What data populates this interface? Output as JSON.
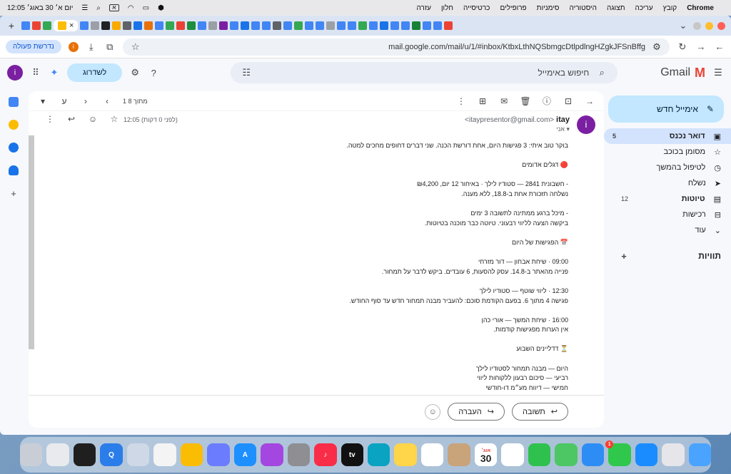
{
  "menubar": {
    "apple": "",
    "app": "Chrome",
    "menus": [
      "קובץ",
      "עריכה",
      "תצוגה",
      "היסטוריה",
      "סימניות",
      "פרופילים",
      "כרטיסייה",
      "חלון",
      "עזרה"
    ],
    "datetime": "יום א׳ 30 באוג׳ 12:05",
    "input_lang": "א"
  },
  "browser": {
    "url": "mail.google.com/mail/u/1/#inbox/KtbxLthNQSbmgcDtlpdlngHZgkJFSnBffg",
    "action_pill": "נדרשת פעולה",
    "profile_letter": "i",
    "tab_favicon_colors": [
      "#4285f4",
      "#ea4335",
      "#34a853",
      "#fbbc04",
      "#4285f4",
      "#9aa0a6",
      "#202124",
      "#f9ab00",
      "#5f6368",
      "#1a73e8",
      "#e8710a",
      "#4285f4",
      "#34a853",
      "#ea4335",
      "#1e8e3e",
      "#4285f4",
      "#9aa0a6",
      "#7b1fa2",
      "#4285f4",
      "#1a73e8",
      "#4285f4",
      "#4285f4",
      "#5f6368",
      "#4285f4",
      "#34a853",
      "#4285f4",
      "#4285f4",
      "#9aa0a6",
      "#4285f4",
      "#4285f4",
      "#34a853",
      "#4285f4",
      "#1a73e8",
      "#4285f4",
      "#4285f4",
      "#188038",
      "#4285f4",
      "#4285f4",
      "#ea4335"
    ]
  },
  "gmail": {
    "logo_text": "Gmail",
    "search_placeholder": "חיפוש באימייל",
    "upgrade": "לשדרוג",
    "avatar": "i",
    "compose": "אימייל חדש",
    "nav": [
      {
        "label": "דואר נכנס",
        "count": "5",
        "icon": "inbox-icon",
        "active": true,
        "bold": true
      },
      {
        "label": "מסומן בכוכב",
        "count": "",
        "icon": "star-icon",
        "active": false,
        "bold": false
      },
      {
        "label": "לטיפול בהמשך",
        "count": "",
        "icon": "clock-icon",
        "active": false,
        "bold": false
      },
      {
        "label": "נשלח",
        "count": "",
        "icon": "send-icon",
        "active": false,
        "bold": false
      },
      {
        "label": "טיוטות",
        "count": "12",
        "icon": "draft-icon",
        "active": false,
        "bold": true
      },
      {
        "label": "רכישות",
        "count": "",
        "icon": "cart-icon",
        "active": false,
        "bold": false
      },
      {
        "label": "עוד",
        "count": "",
        "icon": "chevron-down-icon",
        "active": false,
        "bold": false
      }
    ],
    "labels_title": "תוויות",
    "pagination": "1 מתוך 8",
    "lang_toggle": "ע"
  },
  "email": {
    "sender_name": "itay",
    "sender_email": "<itaypresentor@gmail.com>",
    "to": "אני",
    "time": "12:05 (לפני 0 דקות)",
    "avatar": "i",
    "body": [
      "בוקר טוב איתי: 3 פגישות היום, אחת דורשת הכנה. שני דברים דחופים מחכים למטה.",
      "",
      "🔴 דגלים אדומים",
      "",
      "- חשבונית 2841 — סטודיו לילך · באיחור 12 יום, ₪4,200",
      "  נשלחה תזכורת אחת ב-18.8, ללא מענה.",
      "",
      "- מיכל ברגע ממתינה לתשובה 3 ימים",
      "  ביקשה הצעה לליווי רבעוני. טיוטה כבר מוכנה בטיוטות.",
      "",
      "📅 הפגישות של היום",
      "",
      "09:00 · שיחת אבחון — דור מזרחי",
      "  פנייה מהאתר ב-14.8. עסק להסעות, 6 עובדים. ביקש לדבר על תמחור.",
      "",
      "12:30 · ליווי שוטף — סטודיו לילך",
      "  פגישה 4 מתוך 6. בפעם הקודמת סוכם: להעביר מבנה תמחור חדש עד סוף החודש.",
      "",
      "16:00 · שיחת המשך — אורי כהן",
      "  אין הערות מפגישות קודמות.",
      "",
      "⏳ דדליינים השבוע",
      "",
      "היום — מבנה תמחור לסטודיו לילך",
      "רביעי — סיכום רבעון ללקוחות ליווי",
      "חמישי — דיווח מע״מ דו-חודשי"
    ],
    "reply": "תשובה",
    "forward": "העברה"
  },
  "dock": {
    "apps": [
      {
        "name": "trash",
        "color": "#c9ced6",
        "label": ""
      },
      {
        "name": "chrome-small",
        "color": "#e8eaed",
        "label": ""
      },
      {
        "name": "cursor",
        "color": "#1f1f1f",
        "label": ""
      },
      {
        "name": "qreate",
        "color": "#2b7de9",
        "label": "Q"
      },
      {
        "name": "chatgpt",
        "color": "#cfd8e6",
        "label": ""
      },
      {
        "name": "notes-list",
        "color": "#f4f4f4",
        "label": ""
      },
      {
        "name": "chrome",
        "color": "#fbbc04",
        "label": ""
      },
      {
        "name": "files",
        "color": "#6b7cff",
        "label": ""
      },
      {
        "name": "app-store",
        "color": "#1e8fff",
        "label": "A"
      },
      {
        "name": "podcasts",
        "color": "#a447e0",
        "label": ""
      },
      {
        "name": "settings",
        "color": "#8e8e93",
        "label": ""
      },
      {
        "name": "music",
        "color": "#fa2d48",
        "label": "♪"
      },
      {
        "name": "apple-tv",
        "color": "#111111",
        "label": "tv"
      },
      {
        "name": "freeform",
        "color": "#0aa3c2",
        "label": ""
      },
      {
        "name": "notes",
        "color": "#ffd54a",
        "label": ""
      },
      {
        "name": "reminders",
        "color": "#ffffff",
        "label": ""
      },
      {
        "name": "contacts",
        "color": "#c9a37a",
        "label": ""
      },
      {
        "name": "calendar",
        "color": "#ffffff",
        "label": "30"
      },
      {
        "name": "photos",
        "color": "#ffffff",
        "label": ""
      },
      {
        "name": "facetime",
        "color": "#2fc14e",
        "label": ""
      },
      {
        "name": "maps",
        "color": "#4cc764",
        "label": ""
      },
      {
        "name": "mail",
        "color": "#2e8df5",
        "label": ""
      },
      {
        "name": "messages",
        "color": "#30c84c",
        "label": ""
      },
      {
        "name": "safari",
        "color": "#1a8cff",
        "label": ""
      },
      {
        "name": "launchpad",
        "color": "#e5e5ea",
        "label": ""
      },
      {
        "name": "finder",
        "color": "#4aa3ff",
        "label": ""
      }
    ],
    "calendar_month": "אוג׳",
    "messages_badge": "1"
  }
}
